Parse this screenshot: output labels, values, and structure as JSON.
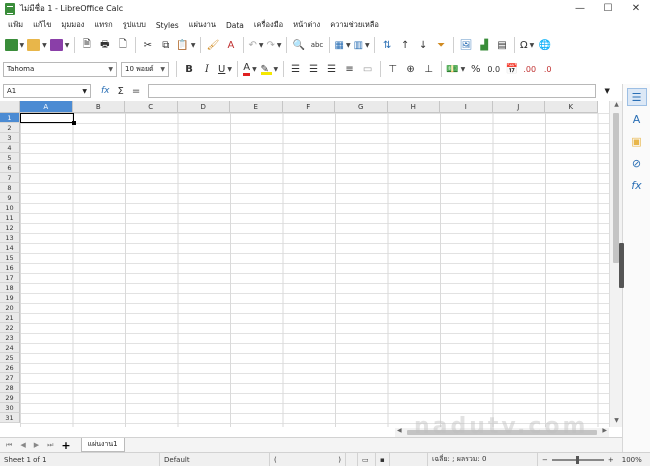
{
  "window": {
    "title": "ไม่มีชื่อ 1 - LibreOffice Calc",
    "controls": {
      "minimize": "—",
      "maximize": "☐",
      "close": "✕"
    }
  },
  "menu": [
    "แฟ้ม",
    "แก้ไข",
    "มุมมอง",
    "แทรก",
    "รูปแบบ",
    "Styles",
    "แผ่นงาน",
    "Data",
    "เครื่องมือ",
    "หน้าต่าง",
    "ความช่วยเหลือ"
  ],
  "toolbar1": {
    "icons": [
      "new-icon",
      "open-icon",
      "save-icon",
      "export-pdf-icon",
      "print-icon",
      "print-preview-icon",
      "cut-icon",
      "copy-icon",
      "paste-icon",
      "clone-format-icon",
      "clear-format-icon",
      "undo-icon",
      "redo-icon",
      "find-replace-icon",
      "spelling-icon",
      "row-icon",
      "column-icon",
      "sort-icon",
      "sort-asc-icon",
      "sort-desc-icon",
      "autofilter-icon",
      "image-icon",
      "chart-icon",
      "pivot-table-icon",
      "special-character-icon",
      "hyperlink-icon"
    ]
  },
  "toolbar2": {
    "font_name": "Tahoma",
    "font_size": "10 พอยต์",
    "bold": "B",
    "italic": "I",
    "underline": "U",
    "font_color_glyph": "A",
    "font_color": "#e02020",
    "highlight_color": "#f5e800",
    "percent": "%",
    "number_format": "0.0",
    "add_decimal": ".00",
    "remove_decimal": ".0"
  },
  "formula_bar": {
    "name_box": "A1",
    "fx": "fx",
    "sigma": "Σ",
    "equals": "=",
    "formula_value": ""
  },
  "grid": {
    "columns": [
      "A",
      "B",
      "C",
      "D",
      "E",
      "F",
      "G",
      "H",
      "I",
      "J",
      "K"
    ],
    "rows": [
      "1",
      "2",
      "3",
      "4",
      "5",
      "6",
      "7",
      "8",
      "9",
      "10",
      "11",
      "12",
      "13",
      "14",
      "15",
      "16",
      "17",
      "18",
      "19",
      "20",
      "21",
      "22",
      "23",
      "24",
      "25",
      "26",
      "27",
      "28",
      "29",
      "30",
      "31"
    ],
    "selected_column": "A",
    "selected_row": "1",
    "accent_color": "#4b8bd3"
  },
  "sheets": {
    "tabs": [
      "แผ่นงาน1"
    ],
    "add_glyph": "+"
  },
  "status": {
    "sheet_info": "Sheet 1 of 1",
    "page_style": "Default",
    "language": "(",
    "language_close": ")",
    "selection_summary": "เฉลี่ย: ; ผลรวม: 0",
    "zoom_minus": "−",
    "zoom_plus": "+",
    "zoom_level": "100%"
  },
  "watermark": "nadutv.com"
}
